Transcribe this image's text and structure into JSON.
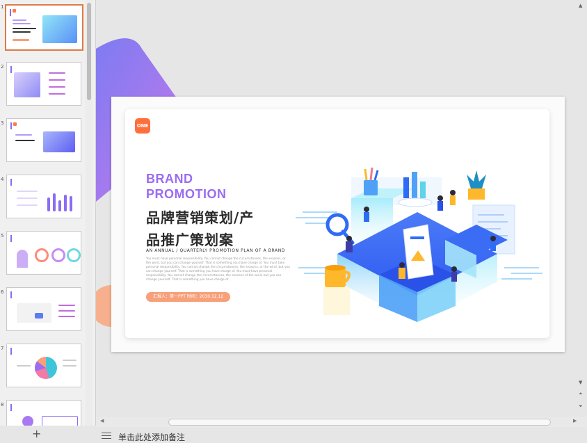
{
  "slide": {
    "badge": "ONE",
    "brand_line1": "BRAND",
    "brand_line2": "PROMOTION",
    "title_line1": "品牌营销策划/产",
    "title_line2": "品推广策划案",
    "subtitle_en": "AN ANNUAL / QUARTERLY PROMOTION PLAN OF A BRAND",
    "description": "You must have personal responsibility. You cannot change the circumstances, the seasons, or the wind, but you can change yourself. That is something you have charge of. You must take personal responsibility. You cannot change the circumstances, the seasons, or the wind, but you can change yourself. That is something you have charge of. You must have personal responsibility. You cannot change the circumstances, the seasons of the wind, but you can change yourself. That is something you have charge of.",
    "reporter": "汇报人：第一PPT   时间：2030.12.12"
  },
  "thumbnails": [
    {
      "number": "1",
      "selected": true
    },
    {
      "number": "2",
      "selected": false
    },
    {
      "number": "3",
      "selected": false
    },
    {
      "number": "4",
      "selected": false
    },
    {
      "number": "5",
      "selected": false
    },
    {
      "number": "6",
      "selected": false
    },
    {
      "number": "7",
      "selected": false
    },
    {
      "number": "8",
      "selected": false
    }
  ],
  "notes": {
    "placeholder": "单击此处添加备注"
  },
  "icons": {
    "add_slide": "plus-icon",
    "notes": "notes-lines-icon",
    "scroll_up": "triangle-up-icon",
    "scroll_down": "triangle-down-icon",
    "page_up": "double-triangle-up-icon",
    "page_down": "double-triangle-down-icon"
  },
  "colors": {
    "accent_orange": "#ff6f3c",
    "brand_purple": "#9b6cf2",
    "illustration_blue": "#2f6cf5"
  }
}
